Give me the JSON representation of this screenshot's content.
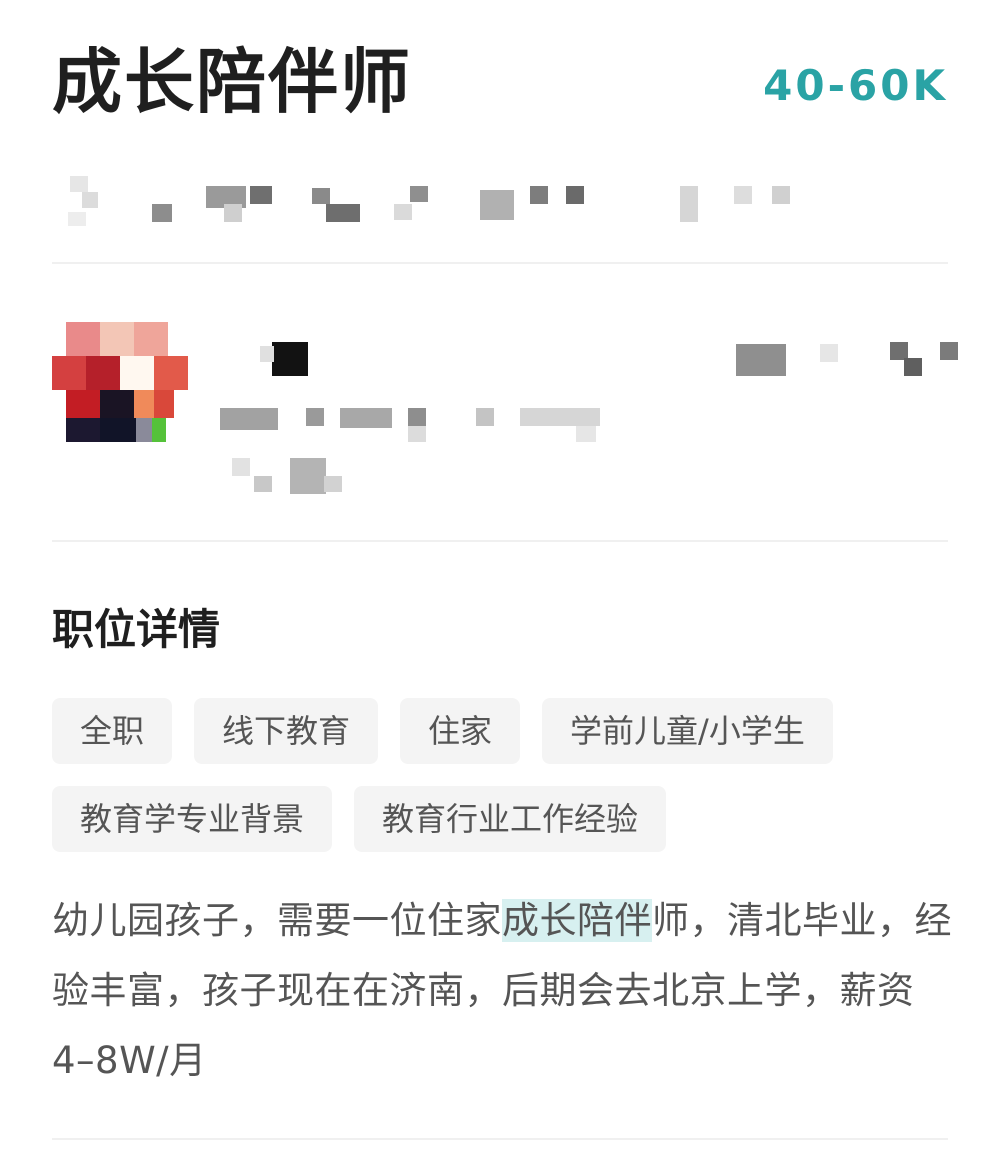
{
  "job": {
    "title": "成长陪伴师",
    "salary": "40-60K"
  },
  "recruiter": {
    "avatar_icon": "recruiter-avatar-icon"
  },
  "details": {
    "section_title": "职位详情",
    "tags": [
      "全职",
      "线下教育",
      "住家",
      "学前儿童/小学生",
      "教育学专业背景",
      "教育行业工作经验"
    ],
    "description_before": "幼儿园孩子，需要一位住家",
    "description_highlight": "成长陪伴",
    "description_after": "师，清北毕业，经验丰富，孩子现在在济南，后期会去北京上学，薪资4–8W/月"
  },
  "colors": {
    "accent": "#2aa3a5",
    "highlight": "#d7f0f0",
    "tag_bg": "#f4f4f4"
  }
}
